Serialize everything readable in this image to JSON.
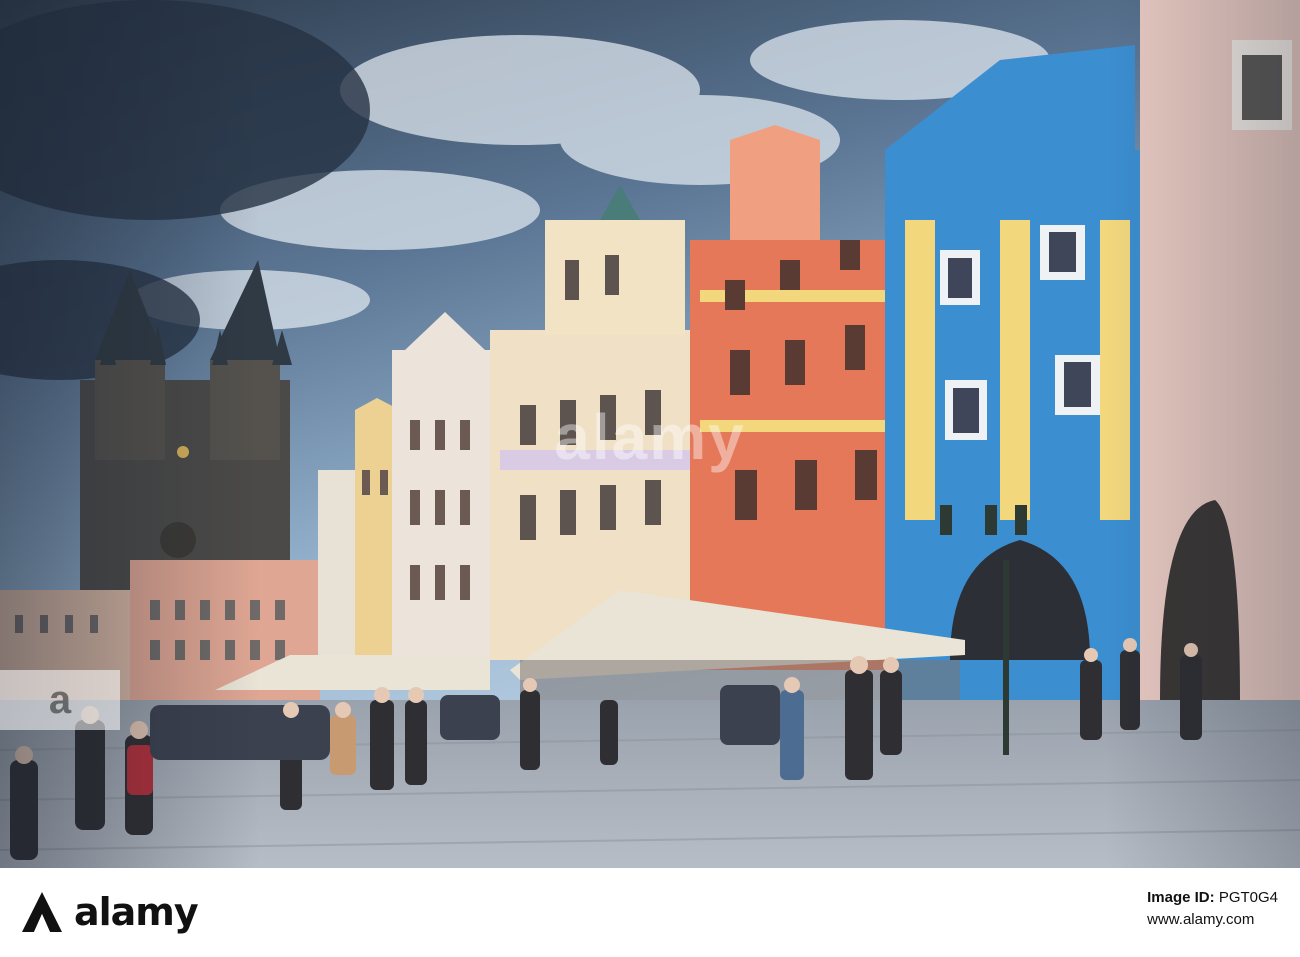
{
  "watermark": {
    "center_text": "alamy",
    "left_text": "a"
  },
  "footer": {
    "logo_text": "alamy",
    "image_id_label": "Image ID:",
    "image_id_value": "PGT0G4",
    "site_url": "www.alamy.com"
  },
  "colors": {
    "sky_top": "#3b4b5e",
    "sky_light": "#8fb3d4",
    "cloud": "#d9e3ea",
    "church": "#4b4a48",
    "pink_building": "#dfa693",
    "cream_building": "#efe0c6",
    "orange_building": "#e6785a",
    "blue_building": "#3b8ed0",
    "yellow_trim": "#f2d77c",
    "pavement": "#a9b0b9",
    "awning": "#e9e4d6"
  }
}
